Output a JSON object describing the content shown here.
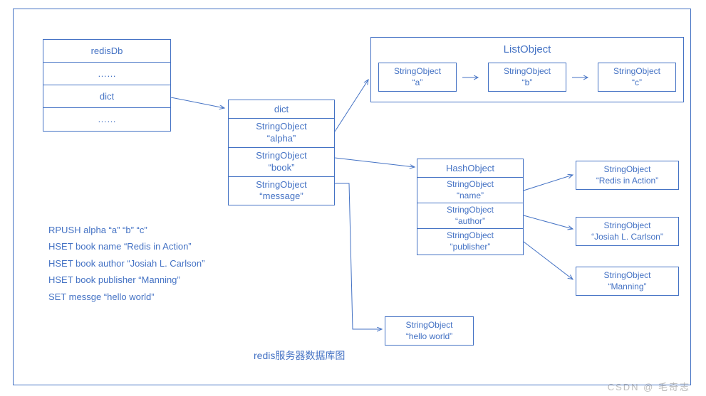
{
  "redisdb": {
    "title": "redisDb",
    "ellipsis": "……",
    "dict_label": "dict"
  },
  "dict": {
    "title": "dict",
    "entries": [
      {
        "type": "StringObject",
        "value": "“alpha”"
      },
      {
        "type": "StringObject",
        "value": "“book”"
      },
      {
        "type": "StringObject",
        "value": "“message”"
      }
    ]
  },
  "listObject": {
    "title": "ListObject",
    "items": [
      {
        "type": "StringObject",
        "value": "“a”"
      },
      {
        "type": "StringObject",
        "value": "“b”"
      },
      {
        "type": "StringObject",
        "value": "“c”"
      }
    ]
  },
  "hashObject": {
    "title": "HashObject",
    "fields": [
      {
        "type": "StringObject",
        "key": "“name”"
      },
      {
        "type": "StringObject",
        "key": "“author”"
      },
      {
        "type": "StringObject",
        "key": "“publisher”"
      }
    ],
    "values": [
      {
        "type": "StringObject",
        "value": "“Redis in Action”"
      },
      {
        "type": "StringObject",
        "value": "“Josiah L. Carlson”"
      },
      {
        "type": "StringObject",
        "value": "“Manning”"
      }
    ]
  },
  "messageValue": {
    "type": "StringObject",
    "value": "“hello world”"
  },
  "commands": [
    "RPUSH  alpha  “a” “b” “c”",
    "HSET book name  “Redis in Action”",
    "HSET book author “Josiah L. Carlson”",
    "HSET book publisher   “Manning”",
    "SET messge  “hello world”"
  ],
  "caption": "redis服务器数据库图",
  "watermark": "CSDN @ 毛奇志"
}
